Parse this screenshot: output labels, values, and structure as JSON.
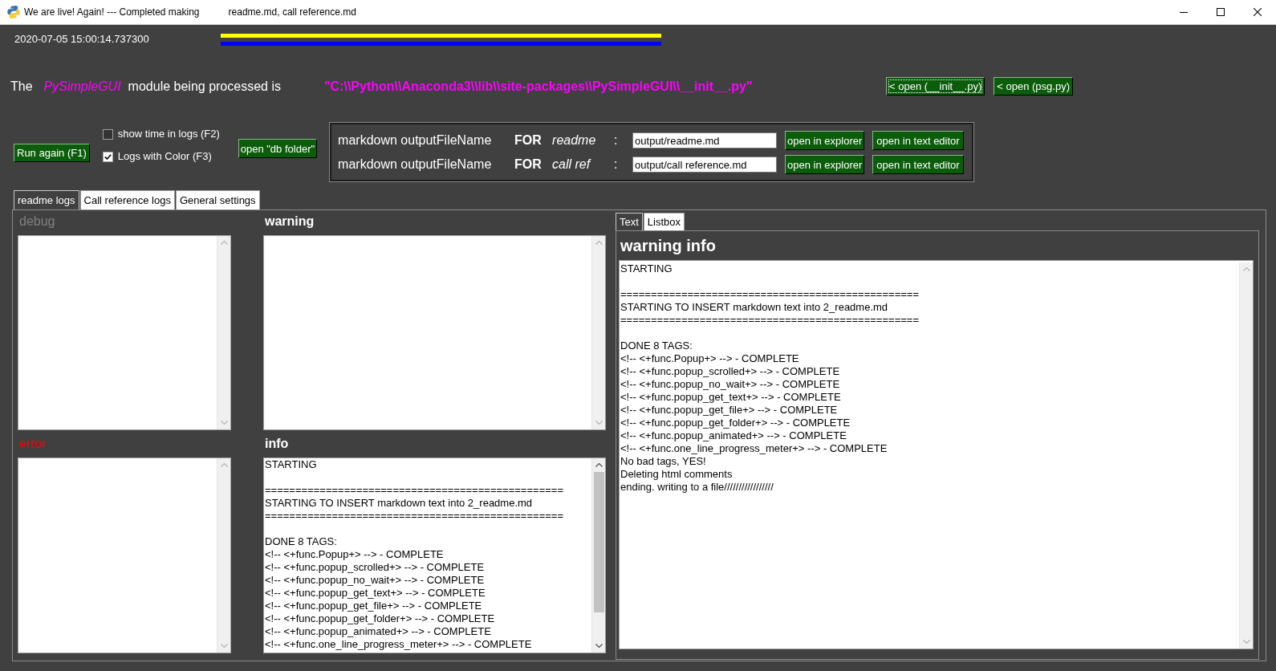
{
  "window": {
    "title_parts": [
      "We are live! Again! --- Completed making",
      "readme.md, call reference.md"
    ]
  },
  "header": {
    "timestamp": "2020-07-05 15:00:14.737300"
  },
  "module_line": {
    "intro": "The",
    "module": "PySimpleGUI",
    "middle": "module being processed is",
    "path": "\"C:\\\\Python\\\\Anaconda3\\\\lib\\\\site-packages\\\\PySimpleGUI\\\\__init__.py\"",
    "buttons": [
      {
        "label": "< open (__init__.py)",
        "focused": true
      },
      {
        "label": "< open (psg.py)",
        "focused": false
      }
    ]
  },
  "controls": {
    "run_button": "Run again (F1)",
    "checkboxes": [
      {
        "label": "show time in logs (F2)",
        "checked": false
      },
      {
        "label": "Logs with Color (F3)",
        "checked": true
      }
    ],
    "db_button": "open \"db folder\""
  },
  "output_files": [
    {
      "label": "markdown outputFileName",
      "keyword": "FOR",
      "target": "readme",
      "separator": ":",
      "value": "output/readme.md",
      "buttons": [
        "open in explorer",
        "open in text editor"
      ]
    },
    {
      "label": "markdown outputFileName",
      "keyword": "FOR",
      "target": "call ref",
      "separator": ":",
      "value": "output/call reference.md",
      "buttons": [
        "open in explorer",
        "open in text editor"
      ]
    }
  ],
  "tabs": [
    {
      "label": "readme logs",
      "selected": true
    },
    {
      "label": "Call reference logs",
      "selected": false
    },
    {
      "label": "General settings",
      "selected": false
    }
  ],
  "log_panels": [
    {
      "title": "debug",
      "color": "#808080",
      "bold": false
    },
    {
      "title": "warning",
      "color": "#ffffff",
      "bold": true
    },
    {
      "title": "error",
      "color": "#ff0000",
      "bold": false
    },
    {
      "title": "info",
      "color": "#ffffff",
      "bold": true,
      "text": "STARTING\n\n=================================================\nSTARTING TO INSERT markdown text into 2_readme.md\n=================================================\n\nDONE 8 TAGS:\n<!-- <+func.Popup+> --> - COMPLETE\n<!-- <+func.popup_scrolled+> --> - COMPLETE\n<!-- <+func.popup_no_wait+> --> - COMPLETE\n<!-- <+func.popup_get_text+> --> - COMPLETE\n<!-- <+func.popup_get_file+> --> - COMPLETE\n<!-- <+func.popup_get_folder+> --> - COMPLETE\n<!-- <+func.popup_animated+> --> - COMPLETE\n<!-- <+func.one_line_progress_meter+> --> - COMPLETE"
    }
  ],
  "side_panel": {
    "tabs": [
      {
        "label": "Text",
        "selected": true
      },
      {
        "label": "Listbox",
        "selected": false
      }
    ],
    "title": "warning info",
    "text": "STARTING\n\n=================================================\nSTARTING TO INSERT markdown text into 2_readme.md\n=================================================\n\nDONE 8 TAGS:\n<!-- <+func.Popup+> --> - COMPLETE\n<!-- <+func.popup_scrolled+> --> - COMPLETE\n<!-- <+func.popup_no_wait+> --> - COMPLETE\n<!-- <+func.popup_get_text+> --> - COMPLETE\n<!-- <+func.popup_get_file+> --> - COMPLETE\n<!-- <+func.popup_get_folder+> --> - COMPLETE\n<!-- <+func.popup_animated+> --> - COMPLETE\n<!-- <+func.one_line_progress_meter+> --> - COMPLETE\nNo bad tags, YES!\nDeleting html comments\nending. writing to a file/////////////////"
  }
}
